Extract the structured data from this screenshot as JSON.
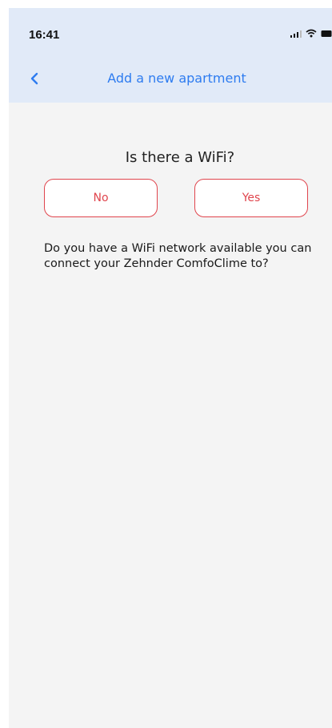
{
  "status_bar": {
    "time": "16:41",
    "icons": [
      "signal-icon",
      "wifi-icon",
      "battery-icon"
    ]
  },
  "nav": {
    "back_icon": "chevron-left-icon",
    "title": "Add a new apartment"
  },
  "content": {
    "question": "Is there a WiFi?",
    "no_label": "No",
    "yes_label": "Yes",
    "description": "Do you have a WiFi network available you can connect your Zehnder ComfoClime to?"
  },
  "colors": {
    "header_bg": "#e1eaf8",
    "page_bg": "#f4f4f4",
    "accent_blue": "#2e7cf0",
    "button_red": "#e0454d"
  }
}
